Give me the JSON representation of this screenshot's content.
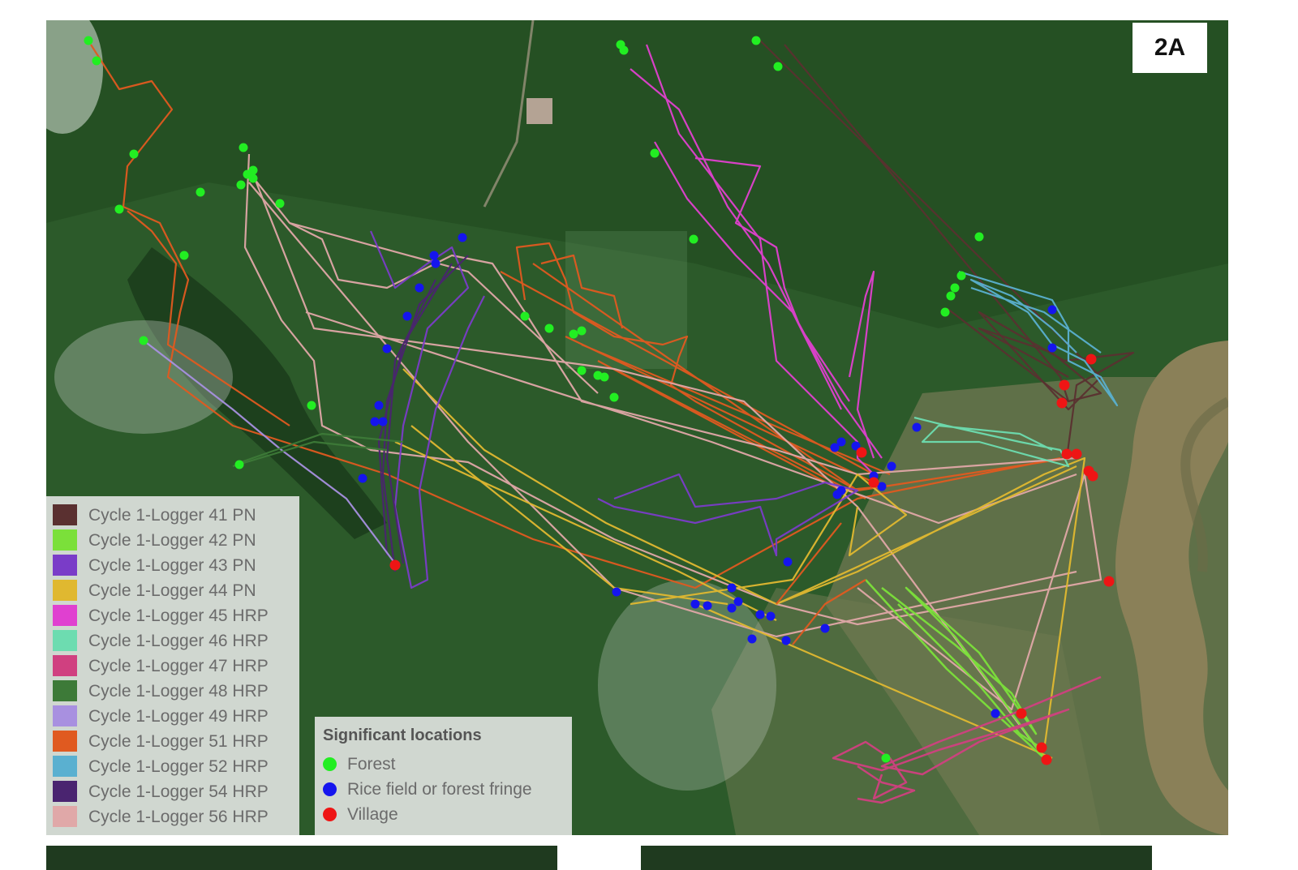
{
  "panel_label": "2A",
  "colors": {
    "forest": "#22ee22",
    "rice": "#1515ee",
    "village": "#ee1515"
  },
  "legend": {
    "loggers": [
      {
        "label": "Cycle 1-Logger 41 PN",
        "color": "#5a3030"
      },
      {
        "label": "Cycle 1-Logger 42 PN",
        "color": "#7be03a"
      },
      {
        "label": "Cycle 1-Logger 43 PN",
        "color": "#7a3cc8"
      },
      {
        "label": "Cycle 1-Logger 44 PN",
        "color": "#e0b830"
      },
      {
        "label": "Cycle 1-Logger 45 HRP",
        "color": "#e040d0"
      },
      {
        "label": "Cycle 1-Logger 46 HRP",
        "color": "#6ddcb0"
      },
      {
        "label": "Cycle 1-Logger 47 HRP",
        "color": "#d04080"
      },
      {
        "label": "Cycle 1-Logger 48 HRP",
        "color": "#3d7a38"
      },
      {
        "label": "Cycle 1-Logger 49 HRP",
        "color": "#a890e0"
      },
      {
        "label": "Cycle 1-Logger 51 HRP",
        "color": "#e05a20"
      },
      {
        "label": "Cycle 1-Logger 52 HRP",
        "color": "#5ab0d0"
      },
      {
        "label": "Cycle 1-Logger 54 HRP",
        "color": "#4a2470"
      },
      {
        "label": "Cycle 1-Logger 56 HRP",
        "color": "#e0a8a8"
      }
    ],
    "locations_title": "Significant locations",
    "locations": [
      {
        "label": "Forest",
        "color": "#22ee22"
      },
      {
        "label": "Rice field or forest fringe",
        "color": "#1515ee"
      },
      {
        "label": "Village",
        "color": "#ee1515"
      }
    ]
  }
}
